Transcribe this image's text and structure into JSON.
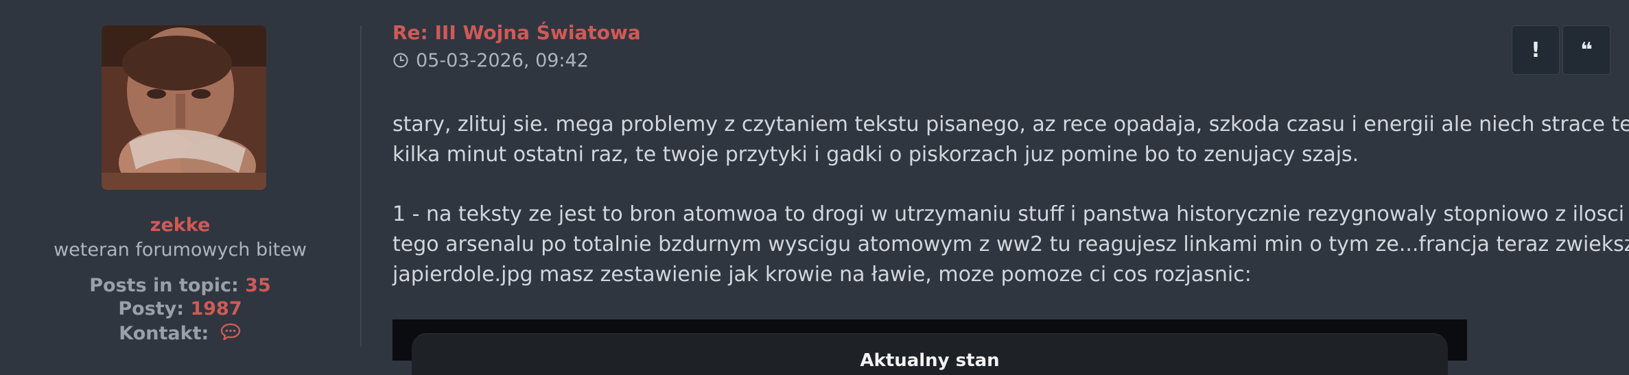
{
  "author": {
    "username": "zekke",
    "rank": "weteran forumowych bitew",
    "stats": {
      "topic_label": "Posts in topic:",
      "topic_value": "35",
      "posts_label": "Posty:",
      "posts_value": "1987",
      "contact_label": "Kontakt:"
    }
  },
  "post": {
    "title": "Re: III Wojna Światowa",
    "datetime": "05-03-2026, 09:42",
    "actions": {
      "report": "!",
      "quote": "❝"
    },
    "paragraphs": [
      [
        "stary, zlituj sie. mega problemy z czytaniem tekstu pisanego, az rece opadaja, szkoda czasu i energii ale niech strace te",
        "kilka minut ostatni raz, te twoje przytyki i gadki o piskorzach juz pomine bo to zenujacy szajs."
      ],
      [
        "1 - na teksty ze jest to bron atomwoa to drogi w utrzymaniu stuff i panstwa historycznie rezygnowaly stopniowo z ilosci",
        "tego arsenalu po totalnie bzdurnym wyscigu atomowym z ww2 tu reagujesz linkami min o tym ze...francja teraz zwieksza,",
        "japierdole.jpg masz zestawienie jak krowie na ławie, moze pomoze ci cos rozjasnic:"
      ]
    ],
    "embed_caption": "Aktualny stan"
  },
  "icons": {
    "clock": "clock-icon",
    "chat": "chat-bubble-icon",
    "report": "exclamation-icon",
    "quote": "quote-icon"
  },
  "colors": {
    "background": "#2f3640",
    "accent": "#d05a56",
    "button_bg": "#222a33"
  }
}
